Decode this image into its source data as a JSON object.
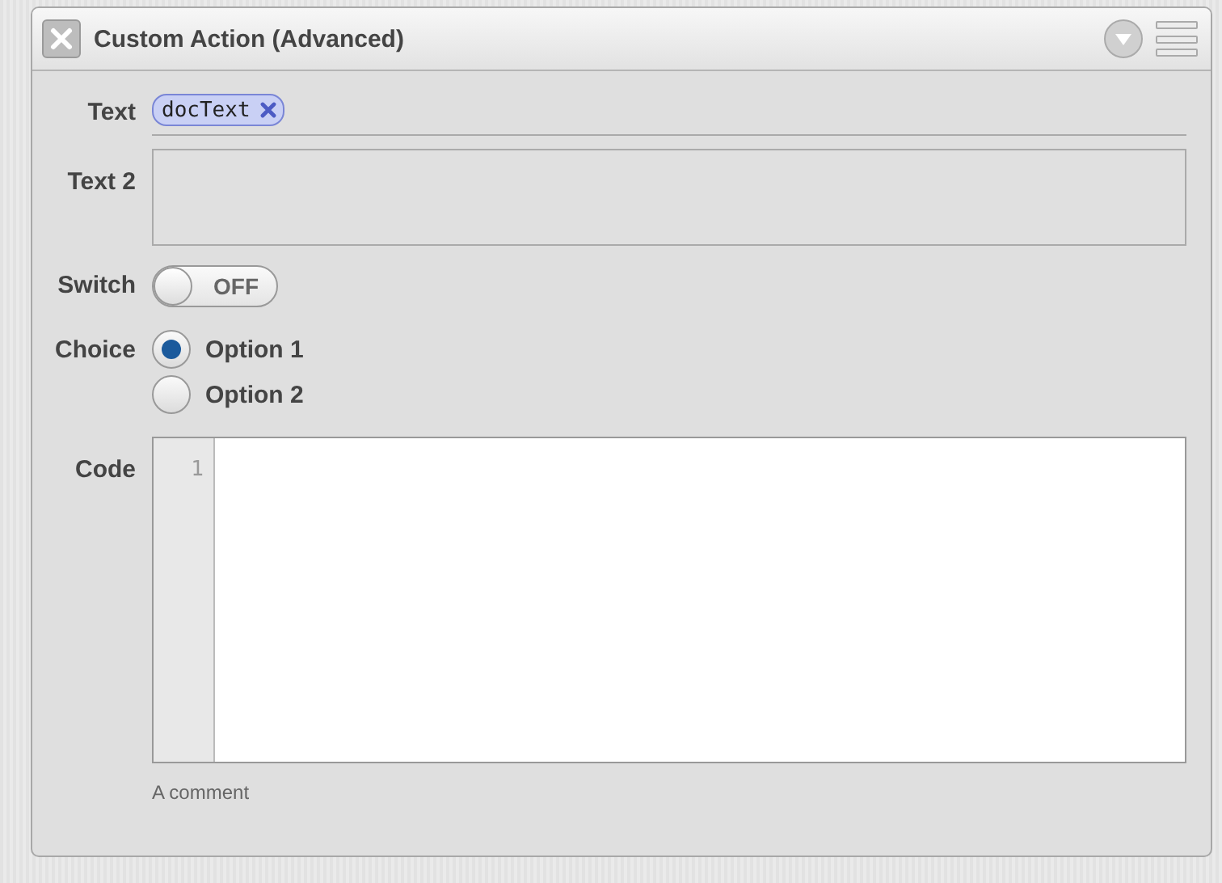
{
  "window": {
    "title": "Custom Action (Advanced)"
  },
  "fields": [
    {
      "kind": "tokens",
      "label": "Text",
      "tokens": [
        "docText"
      ]
    },
    {
      "kind": "textarea",
      "label": "Text 2"
    },
    {
      "kind": "switch",
      "label": "Switch",
      "on": false,
      "state_text": "OFF"
    },
    {
      "kind": "radio",
      "label": "Choice",
      "options": [
        {
          "label": "Option 1",
          "selected": true
        },
        {
          "label": "Option 2",
          "selected": false
        }
      ]
    },
    {
      "kind": "code",
      "label": "Code",
      "line_numbers": [
        "1"
      ],
      "comment": "A comment"
    }
  ]
}
